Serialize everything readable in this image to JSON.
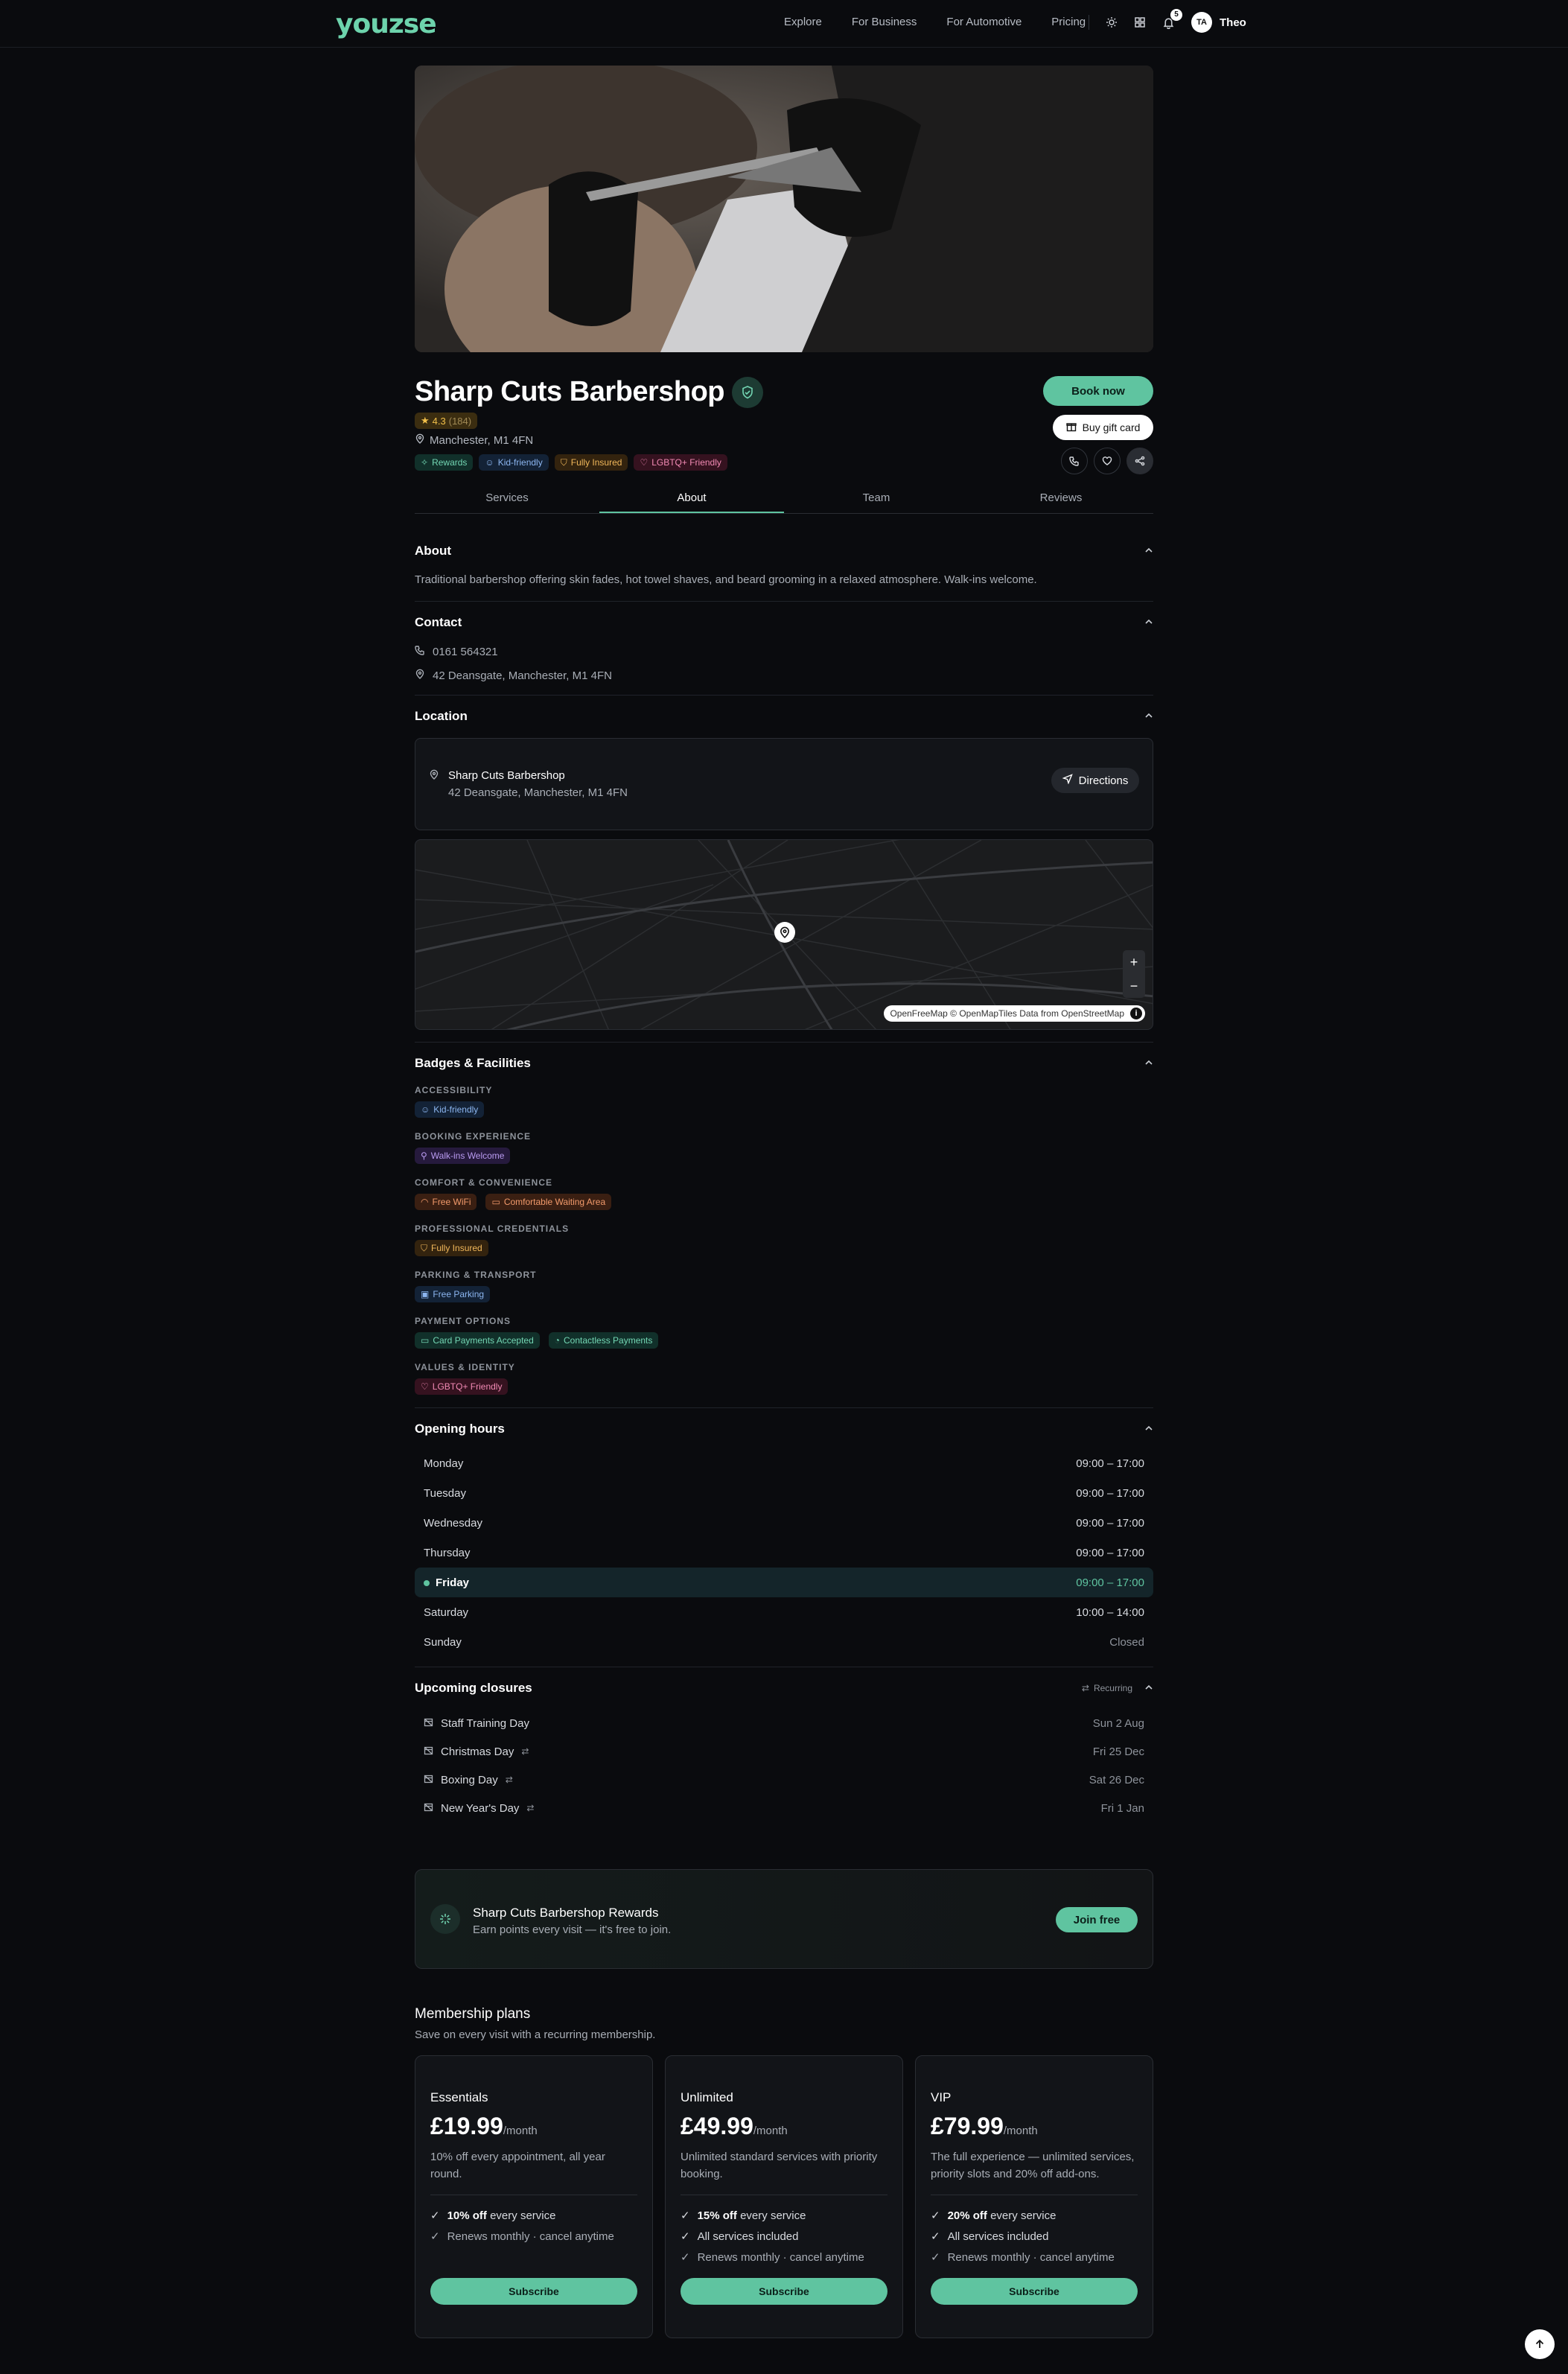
{
  "brand": "youzse",
  "nav": {
    "links": [
      "Explore",
      "For Business",
      "For Automotive",
      "Pricing"
    ],
    "notifications": "5",
    "avatar_initials": "TA",
    "user_name": "Theo"
  },
  "business": {
    "name": "Sharp Cuts Barbershop",
    "rating": "4.3",
    "review_count": "(184)",
    "location": "Manchester, M1 4FN",
    "tags": [
      "Rewards",
      "Kid-friendly",
      "Fully Insured",
      "LGBTQ+ Friendly"
    ]
  },
  "actions": {
    "book": "Book now",
    "gift": "Buy gift card"
  },
  "tabs": [
    "Services",
    "About",
    "Team",
    "Reviews"
  ],
  "active_tab": "About",
  "about": {
    "heading": "About",
    "text": "Traditional barbershop offering skin fades, hot towel shaves, and beard grooming in a relaxed atmosphere. Walk-ins welcome."
  },
  "contact": {
    "heading": "Contact",
    "phone": "0161 564321",
    "address": "42 Deansgate, Manchester, M1 4FN"
  },
  "location": {
    "heading": "Location",
    "name": "Sharp Cuts Barbershop",
    "address": "42 Deansgate, Manchester, M1 4FN",
    "directions": "Directions",
    "zoom_in": "+",
    "zoom_out": "−",
    "attribution": "OpenFreeMap © OpenMapTiles Data from OpenStreetMap",
    "attribution_info": "i"
  },
  "badges": {
    "heading": "Badges & Facilities",
    "groups": [
      {
        "title": "ACCESSIBILITY",
        "items": [
          "Kid-friendly"
        ]
      },
      {
        "title": "BOOKING EXPERIENCE",
        "items": [
          "Walk-ins Welcome"
        ]
      },
      {
        "title": "COMFORT & CONVENIENCE",
        "items": [
          "Free WiFi",
          "Comfortable Waiting Area"
        ]
      },
      {
        "title": "PROFESSIONAL CREDENTIALS",
        "items": [
          "Fully Insured"
        ]
      },
      {
        "title": "PARKING & TRANSPORT",
        "items": [
          "Free Parking"
        ]
      },
      {
        "title": "PAYMENT OPTIONS",
        "items": [
          "Card Payments Accepted",
          "Contactless Payments"
        ]
      },
      {
        "title": "VALUES & IDENTITY",
        "items": [
          "LGBTQ+ Friendly"
        ]
      }
    ]
  },
  "hours": {
    "heading": "Opening hours",
    "days": [
      {
        "day": "Monday",
        "time": "09:00 – 17:00"
      },
      {
        "day": "Tuesday",
        "time": "09:00 – 17:00"
      },
      {
        "day": "Wednesday",
        "time": "09:00 – 17:00"
      },
      {
        "day": "Thursday",
        "time": "09:00 – 17:00"
      },
      {
        "day": "Friday",
        "time": "09:00 – 17:00"
      },
      {
        "day": "Saturday",
        "time": "10:00 – 14:00"
      },
      {
        "day": "Sunday",
        "time": "Closed"
      }
    ]
  },
  "closures": {
    "heading": "Upcoming closures",
    "recurring_label": "Recurring",
    "items": [
      {
        "name": "Staff Training Day",
        "date": "Sun 2 Aug"
      },
      {
        "name": "Christmas Day",
        "date": "Fri 25 Dec"
      },
      {
        "name": "Boxing Day",
        "date": "Sat 26 Dec"
      },
      {
        "name": "New Year's Day",
        "date": "Fri 1 Jan"
      }
    ]
  },
  "rewards": {
    "title": "Sharp Cuts Barbershop Rewards",
    "subtitle": "Earn points every visit — it's free to join.",
    "button": "Join free"
  },
  "membership": {
    "heading": "Membership plans",
    "subheading": "Save on every visit with a recurring membership.",
    "plans": [
      {
        "name": "Essentials",
        "price": "£19.99",
        "period": "/month",
        "desc": "10% off every appointment, all year round.",
        "f1_bold": "10% off",
        "f1_rest": "every service",
        "f2": "Renews monthly · cancel anytime",
        "f3": "",
        "button": "Subscribe"
      },
      {
        "name": "Unlimited",
        "price": "£49.99",
        "period": "/month",
        "desc": "Unlimited standard services with priority booking.",
        "f1_bold": "15% off",
        "f1_rest": "every service",
        "f2": "All services included",
        "f3": "Renews monthly · cancel anytime",
        "button": "Subscribe"
      },
      {
        "name": "VIP",
        "price": "£79.99",
        "period": "/month",
        "desc": "The full experience — unlimited services, priority slots and 20% off add-ons.",
        "f1_bold": "20% off",
        "f1_rest": "every service",
        "f2": "All services included",
        "f3": "Renews monthly · cancel anytime",
        "button": "Subscribe"
      }
    ]
  },
  "colors": {
    "accent": "#5fc4a0",
    "background": "#0a0b0e"
  }
}
